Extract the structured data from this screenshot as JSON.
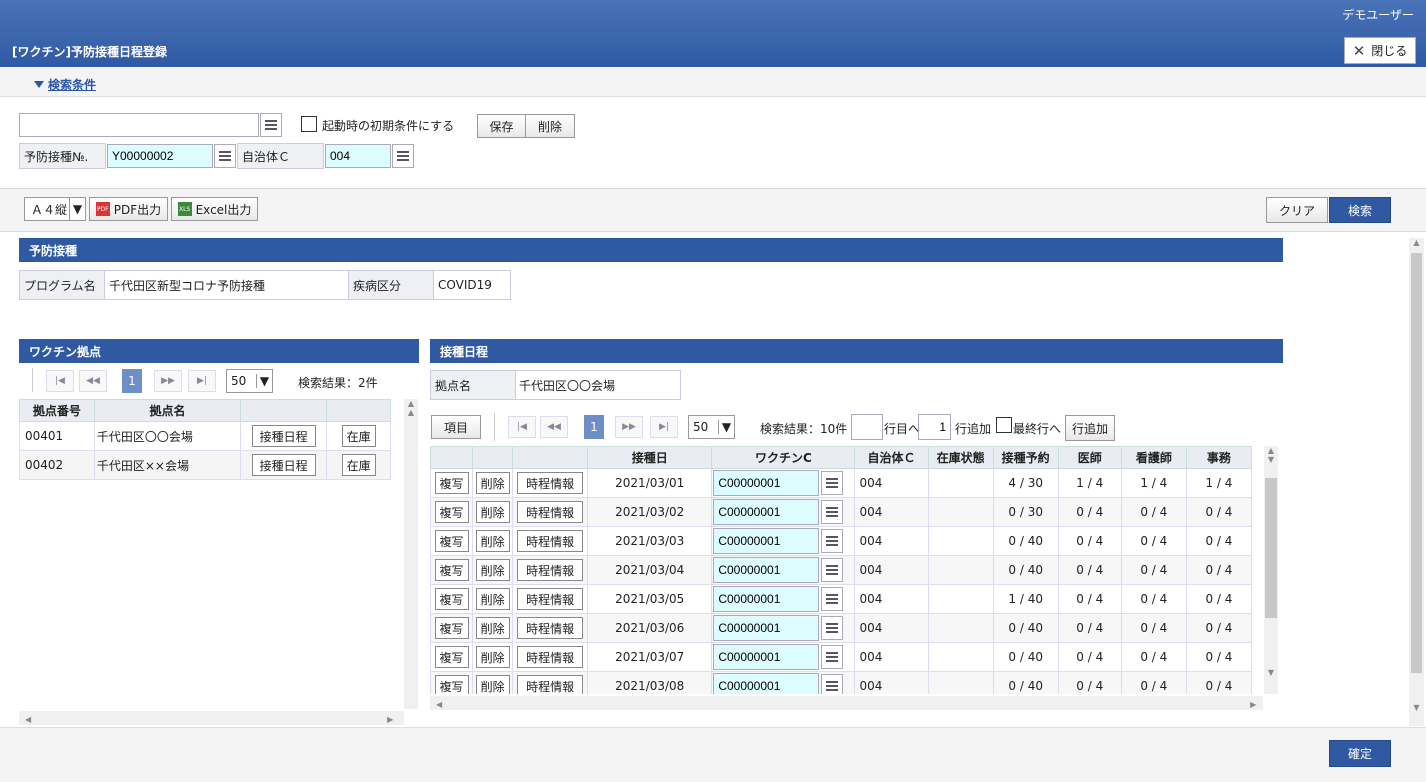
{
  "header": {
    "user": "デモユーザー",
    "title": "[ワクチン]予防接種日程登録",
    "close_label": "閉じる"
  },
  "conditions": {
    "toggle_label": "検索条件",
    "checkbox_label": "起動時の初期条件にする",
    "save_label": "保存",
    "delete_label": "削除",
    "field1_label": "予防接種№.",
    "field1_value": "Y00000002",
    "field2_label": "自治体Ｃ",
    "field2_value": "004"
  },
  "toolbar": {
    "paper": "Ａ４縦",
    "pdf": "PDF出力",
    "excel": "Excel出力",
    "clear": "クリア",
    "search": "検索"
  },
  "program": {
    "section": "予防接種",
    "prog_label": "プログラム名",
    "prog_value": "千代田区新型コロナ予防接種",
    "disease_label": "疾病区分",
    "disease_value": "COVID19"
  },
  "bases": {
    "section": "ワクチン拠点",
    "page": "1",
    "pagesize": "50",
    "result": "検索結果：2件",
    "headers": [
      "拠点番号",
      "拠点名",
      "",
      ""
    ],
    "rows": [
      {
        "code": "00401",
        "name": "千代田区〇〇会場",
        "b1": "接種日程",
        "b2": "在庫"
      },
      {
        "code": "00402",
        "name": "千代田区××会場",
        "b1": "接種日程",
        "b2": "在庫"
      }
    ]
  },
  "schedule": {
    "section": "接種日程",
    "base_label": "拠点名",
    "base_value": "千代田区〇〇会場",
    "items": "項目",
    "page": "1",
    "pagesize": "50",
    "result": "検索結果：10件",
    "goto": "行目へ",
    "add_count": "1",
    "add_label": "行追加",
    "last_label": "最終行へ",
    "add_btn": "行追加",
    "headers": [
      "",
      "",
      "",
      "接種日",
      "ワクチンC",
      "自治体Ｃ",
      "在庫状態",
      "接種予約",
      "医師",
      "看護師",
      "事務"
    ],
    "btn_copy": "複写",
    "btn_del": "削除",
    "btn_time": "時程情報",
    "rows": [
      {
        "date": "2021/03/01",
        "vac": "C00000001",
        "muni": "004",
        "stock": "",
        "resv": "4 / 30",
        "doc": "1 / 4",
        "nurse": "1 / 4",
        "clerk": "1 / 4"
      },
      {
        "date": "2021/03/02",
        "vac": "C00000001",
        "muni": "004",
        "stock": "",
        "resv": "0 / 30",
        "doc": "0 / 4",
        "nurse": "0 / 4",
        "clerk": "0 / 4"
      },
      {
        "date": "2021/03/03",
        "vac": "C00000001",
        "muni": "004",
        "stock": "",
        "resv": "0 / 40",
        "doc": "0 / 4",
        "nurse": "0 / 4",
        "clerk": "0 / 4"
      },
      {
        "date": "2021/03/04",
        "vac": "C00000001",
        "muni": "004",
        "stock": "",
        "resv": "0 / 40",
        "doc": "0 / 4",
        "nurse": "0 / 4",
        "clerk": "0 / 4"
      },
      {
        "date": "2021/03/05",
        "vac": "C00000001",
        "muni": "004",
        "stock": "",
        "resv": "1 / 40",
        "doc": "0 / 4",
        "nurse": "0 / 4",
        "clerk": "0 / 4"
      },
      {
        "date": "2021/03/06",
        "vac": "C00000001",
        "muni": "004",
        "stock": "",
        "resv": "0 / 40",
        "doc": "0 / 4",
        "nurse": "0 / 4",
        "clerk": "0 / 4"
      },
      {
        "date": "2021/03/07",
        "vac": "C00000001",
        "muni": "004",
        "stock": "",
        "resv": "0 / 40",
        "doc": "0 / 4",
        "nurse": "0 / 4",
        "clerk": "0 / 4"
      },
      {
        "date": "2021/03/08",
        "vac": "C00000001",
        "muni": "004",
        "stock": "",
        "resv": "0 / 40",
        "doc": "0 / 4",
        "nurse": "0 / 4",
        "clerk": "0 / 4"
      }
    ]
  },
  "footer": {
    "confirm": "確定"
  },
  "colors": {
    "primary": "#2f5aa3",
    "cyan_field": "#dcfcff"
  }
}
